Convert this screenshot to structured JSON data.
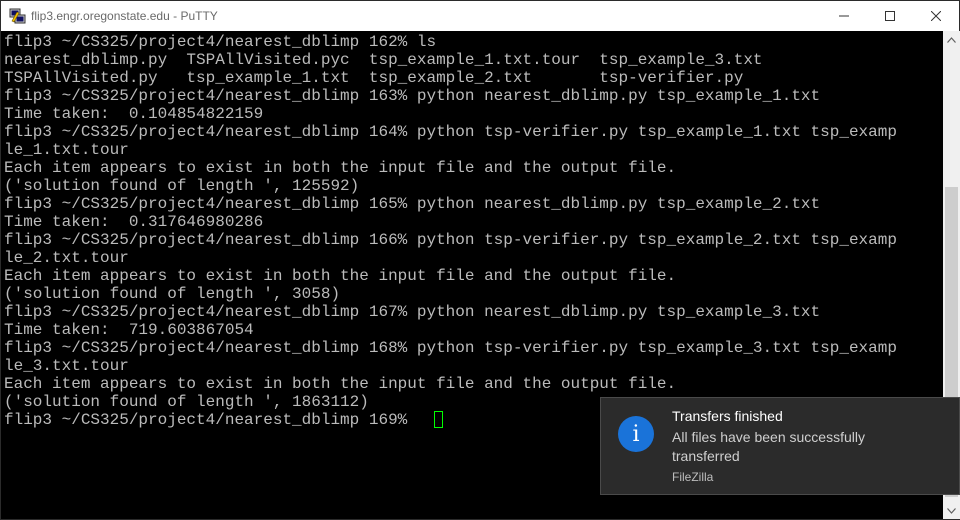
{
  "window": {
    "title": "flip3.engr.oregonstate.edu - PuTTY",
    "icon": "putty-icon"
  },
  "terminal": {
    "lines": [
      "flip3 ~/CS325/project4/nearest_dblimp 162% ls",
      "nearest_dblimp.py  TSPAllVisited.pyc  tsp_example_1.txt.tour  tsp_example_3.txt",
      "TSPAllVisited.py   tsp_example_1.txt  tsp_example_2.txt       tsp-verifier.py",
      "flip3 ~/CS325/project4/nearest_dblimp 163% python nearest_dblimp.py tsp_example_1.txt",
      "Time taken:  0.104854822159",
      "flip3 ~/CS325/project4/nearest_dblimp 164% python tsp-verifier.py tsp_example_1.txt tsp_examp",
      "le_1.txt.tour",
      "Each item appears to exist in both the input file and the output file.",
      "('solution found of length ', 125592)",
      "flip3 ~/CS325/project4/nearest_dblimp 165% python nearest_dblimp.py tsp_example_2.txt",
      "Time taken:  0.317646980286",
      "flip3 ~/CS325/project4/nearest_dblimp 166% python tsp-verifier.py tsp_example_2.txt tsp_examp",
      "le_2.txt.tour",
      "Each item appears to exist in both the input file and the output file.",
      "('solution found of length ', 3058)",
      "flip3 ~/CS325/project4/nearest_dblimp 167% python nearest_dblimp.py tsp_example_3.txt",
      "Time taken:  719.603867054",
      "flip3 ~/CS325/project4/nearest_dblimp 168% python tsp-verifier.py tsp_example_3.txt tsp_examp",
      "le_3.txt.tour",
      "Each item appears to exist in both the input file and the output file.",
      "('solution found of length ', 1863112)",
      "flip3 ~/CS325/project4/nearest_dblimp 169% "
    ],
    "cursor_color": "#00ff00",
    "text_color": "#bbbbbb"
  },
  "notification": {
    "title": "Transfers finished",
    "body": "All files have been successfully transferred",
    "app": "FileZilla",
    "icon": "info-icon",
    "accent": "#1a73d9"
  }
}
